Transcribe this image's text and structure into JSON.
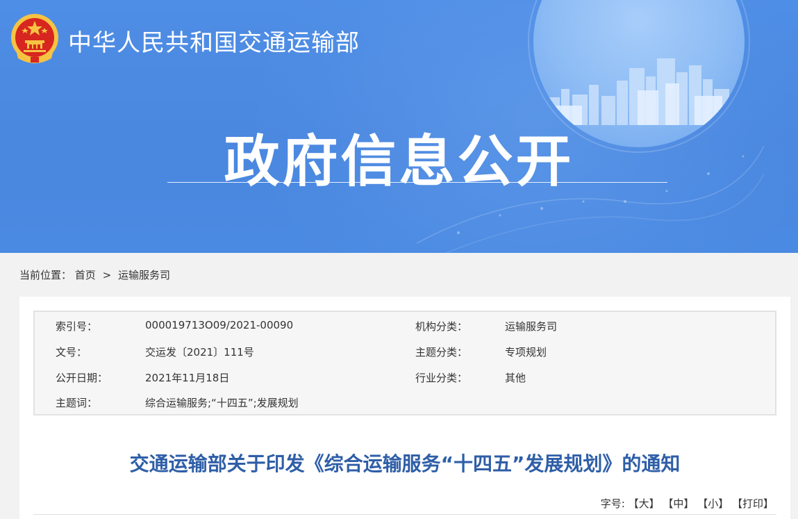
{
  "header": {
    "site_title": "中华人民共和国交通运输部",
    "hero_title": "政府信息公开"
  },
  "breadcrumb": {
    "label": "当前位置：",
    "home": "首页",
    "separator": ">",
    "current": "运输服务司"
  },
  "meta": {
    "index_label": "索引号：",
    "index_value": "000019713O09/2021-00090",
    "org_label": "机构分类：",
    "org_value": "运输服务司",
    "doc_no_label": "文号：",
    "doc_no_value": "交运发〔2021〕111号",
    "topic_label": "主题分类：",
    "topic_value": "专项规划",
    "date_label": "公开日期：",
    "date_value": "2021年11月18日",
    "industry_label": "行业分类：",
    "industry_value": "其他",
    "keywords_label": "主题词：",
    "keywords_value": "综合运输服务;“十四五”;发展规划"
  },
  "article": {
    "title": "交通运输部关于印发《综合运输服务“十四五”发展规划》的通知"
  },
  "font_tools": {
    "label": "字号:",
    "large": "【大】",
    "medium": "【中】",
    "small": "【小】",
    "print": "【打印】"
  },
  "colors": {
    "banner_blue": "#4a87df",
    "title_blue": "#2e5ea7",
    "emblem_red": "#d7261f",
    "emblem_gold": "#f6c343"
  }
}
